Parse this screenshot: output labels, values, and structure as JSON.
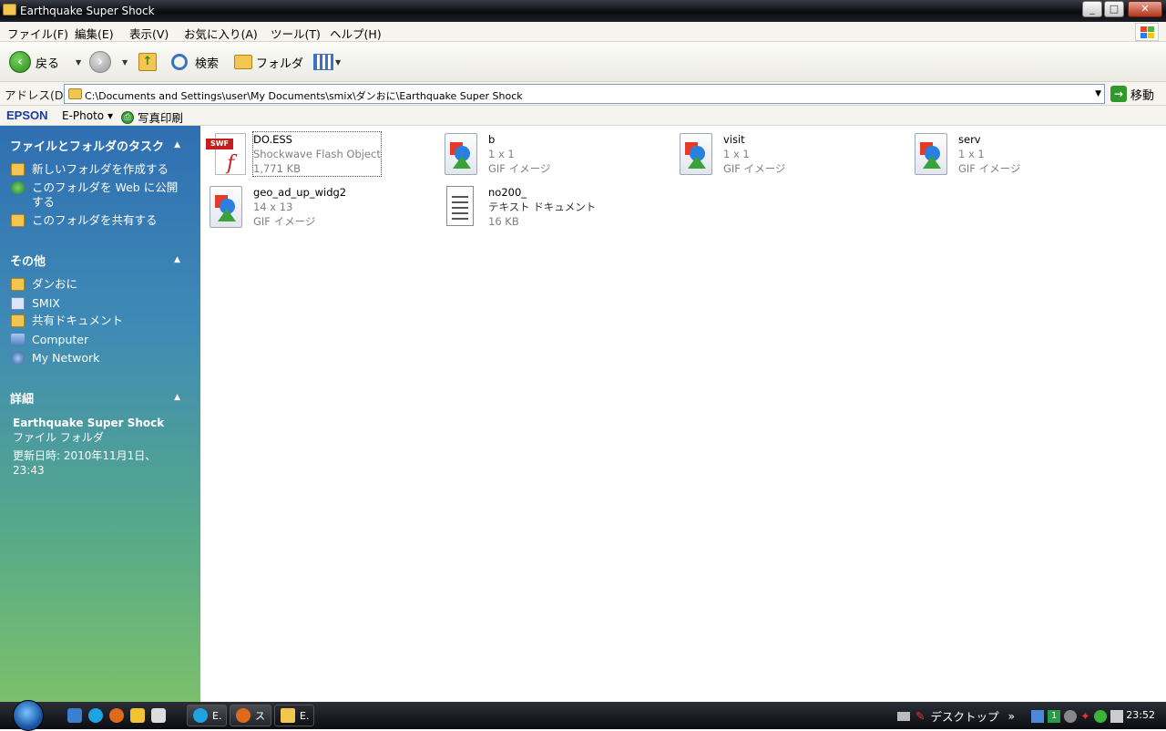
{
  "window": {
    "title": "Earthquake Super Shock",
    "controls": {
      "minimize": "_",
      "maximize": "□",
      "close": "✕"
    }
  },
  "menu": [
    "ファイル(F)",
    "編集(E)",
    "表示(V)",
    "お気に入り(A)",
    "ツール(T)",
    "ヘルプ(H)"
  ],
  "toolbar": {
    "back": "戻る",
    "search": "検索",
    "folders": "フォルダ"
  },
  "address": {
    "label": "アドレス(D)",
    "path": "C:\\Documents and Settings\\user\\My Documents\\smix\\ダンおに\\Earthquake Super Shock",
    "go": "移動"
  },
  "epson": {
    "logo": "EPSON",
    "ephoto": "E-Photo ▾",
    "print": "写真印刷"
  },
  "sidebar": {
    "tasks": {
      "title": "ファイルとフォルダのタスク",
      "items": [
        "新しいフォルダを作成する",
        "このフォルダを Web に公開する",
        "このフォルダを共有する"
      ]
    },
    "other": {
      "title": "その他",
      "items": [
        "ダンおに",
        "SMIX",
        "共有ドキュメント",
        "Computer",
        "My Network"
      ]
    },
    "details": {
      "title": "詳細",
      "name": "Earthquake Super Shock",
      "type": "ファイル フォルダ",
      "modified": "更新日時: 2010年11月1日、23:43"
    }
  },
  "files": [
    {
      "name": "DO.ESS",
      "line2": "Shockwave Flash Object",
      "line3": "1,771 KB",
      "icon": "swf-icon"
    },
    {
      "name": "b",
      "line2": "1 x 1",
      "line3": "GIF イメージ",
      "icon": "gif-icon"
    },
    {
      "name": "visit",
      "line2": "1 x 1",
      "line3": "GIF イメージ",
      "icon": "gif-icon"
    },
    {
      "name": "serv",
      "line2": "1 x 1",
      "line3": "GIF イメージ",
      "icon": "gif-icon"
    },
    {
      "name": "geo_ad_up_widg2",
      "line2": "14 x 13",
      "line3": "GIF イメージ",
      "icon": "gif-icon"
    },
    {
      "name": "no200_",
      "line2": "テキスト ドキュメント",
      "line3": "16 KB",
      "icon": "text-icon"
    }
  ],
  "taskbar": {
    "tasks": [
      "E.",
      "ス",
      "E."
    ],
    "tray_label": "デスクトップ",
    "tray_chevron": "»",
    "clock": "23:52"
  }
}
